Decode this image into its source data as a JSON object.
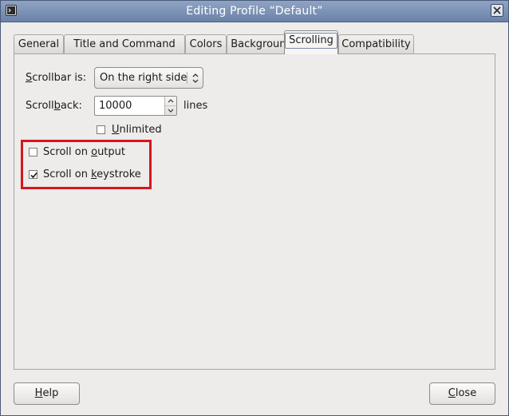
{
  "window": {
    "title": "Editing Profile “Default”"
  },
  "tabs": [
    {
      "label": "General"
    },
    {
      "label": "Title and Command"
    },
    {
      "label": "Colors"
    },
    {
      "label": "Background"
    },
    {
      "label": "Scrolling",
      "active": true
    },
    {
      "label": "Compatibility"
    }
  ],
  "scrolling": {
    "scrollbar_label_mnemonic": "S",
    "scrollbar_label_rest": "crollbar is:",
    "scrollbar_value": "On the right side",
    "scrollback_label_pre": "Scroll",
    "scrollback_label_mnemonic": "b",
    "scrollback_label_rest": "ack:",
    "scrollback_value": "10000",
    "scrollback_unit": "lines",
    "unlimited_mnemonic": "U",
    "unlimited_rest": "nlimited",
    "unlimited_checked": false,
    "scroll_on_output_pre": "Scroll on ",
    "scroll_on_output_mnemonic": "o",
    "scroll_on_output_rest": "utput",
    "scroll_on_output_checked": false,
    "scroll_on_keystroke_pre": "Scroll on ",
    "scroll_on_keystroke_mnemonic": "k",
    "scroll_on_keystroke_rest": "eystroke",
    "scroll_on_keystroke_checked": true
  },
  "buttons": {
    "help_mnemonic": "H",
    "help_rest": "elp",
    "close_mnemonic": "C",
    "close_rest": "lose"
  },
  "colors": {
    "titlebar": "#6b82a8",
    "highlight": "#d8161c",
    "window_bg": "#edeceb"
  }
}
